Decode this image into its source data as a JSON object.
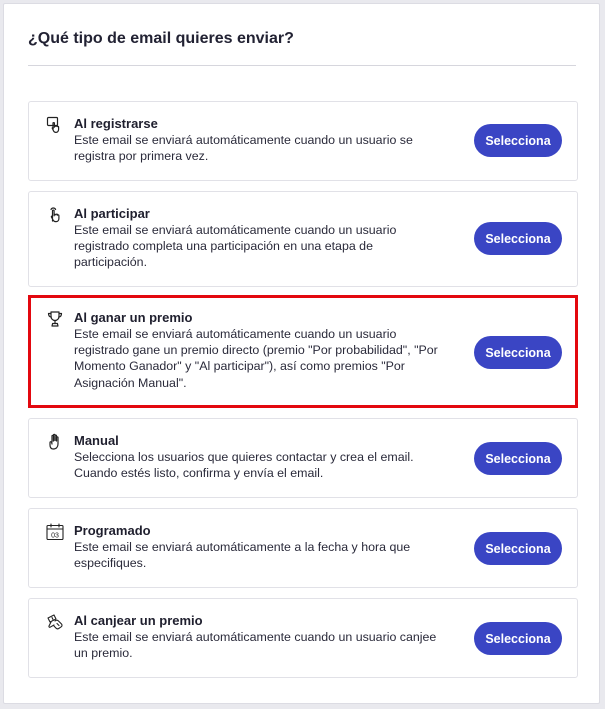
{
  "title": "¿Qué tipo de email quieres enviar?",
  "accent_color": "#3a45c4",
  "highlight_color": "#e3080f",
  "options": [
    {
      "icon": "register-icon",
      "title": "Al registrarse",
      "description": "Este email se enviará automáticamente cuando un usuario se registra por primera vez.",
      "button": "Selecciona"
    },
    {
      "icon": "touch-icon",
      "title": "Al participar",
      "description": "Este email se enviará automáticamente cuando un usuario registrado completa una participación en una etapa de participación.",
      "button": "Selecciona"
    },
    {
      "icon": "trophy-icon",
      "title": "Al ganar un premio",
      "description": "Este email se enviará automáticamente cuando un usuario registrado gane un premio directo (premio \"Por probabilidad\", \"Por Momento Ganador\" y \"Al participar\"), así como premios \"Por Asignación Manual\".",
      "button": "Selecciona",
      "highlighted": true
    },
    {
      "icon": "hand-icon",
      "title": "Manual",
      "description": "Selecciona los usuarios que quieres contactar y crea el email. Cuando estés listo, confirma y envía el email.",
      "button": "Selecciona"
    },
    {
      "icon": "calendar-icon",
      "title": "Programado",
      "description": "Este email se enviará automáticamente a la fecha y hora que especifiques.",
      "button": "Selecciona",
      "icon_text": "03"
    },
    {
      "icon": "redeem-icon",
      "title": "Al canjear un premio",
      "description": "Este email se enviará automáticamente cuando un usuario canjee un premio.",
      "button": "Selecciona"
    }
  ]
}
